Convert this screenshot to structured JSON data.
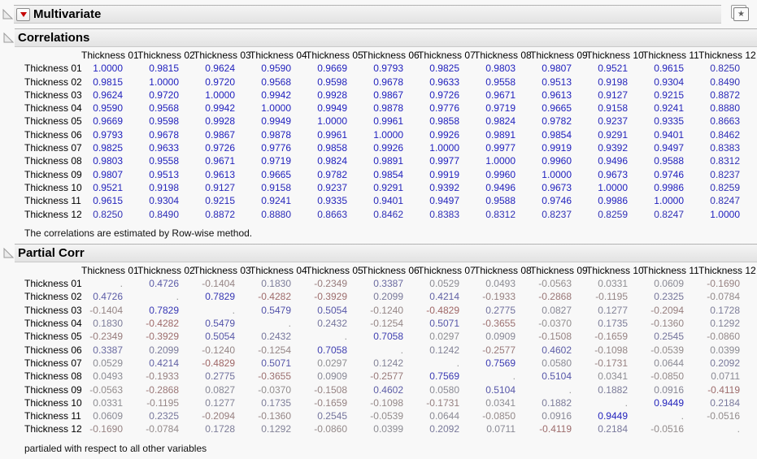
{
  "window": {
    "title": "Multivariate",
    "icons": {
      "red_triangle_menu": "red-triangle-menu",
      "disclosure_open": "open-disclosure-triangle",
      "corner": "window-star"
    }
  },
  "colors": {
    "positive": "#1e1ebe",
    "negative": "#af3737",
    "neutral": "#919191"
  },
  "sections": {
    "correlations": {
      "title": "Correlations",
      "columns": [
        "Thickness 01",
        "Thickness 02",
        "Thickness 03",
        "Thickness 04",
        "Thickness 05",
        "Thickness 06",
        "Thickness 07",
        "Thickness 08",
        "Thickness 09",
        "Thickness 10",
        "Thickness 11",
        "Thickness 12"
      ],
      "rows": [
        {
          "label": "Thickness 01",
          "values": [
            "1.0000",
            "0.9815",
            "0.9624",
            "0.9590",
            "0.9669",
            "0.9793",
            "0.9825",
            "0.9803",
            "0.9807",
            "0.9521",
            "0.9615",
            "0.8250"
          ]
        },
        {
          "label": "Thickness 02",
          "values": [
            "0.9815",
            "1.0000",
            "0.9720",
            "0.9568",
            "0.9598",
            "0.9678",
            "0.9633",
            "0.9558",
            "0.9513",
            "0.9198",
            "0.9304",
            "0.8490"
          ]
        },
        {
          "label": "Thickness 03",
          "values": [
            "0.9624",
            "0.9720",
            "1.0000",
            "0.9942",
            "0.9928",
            "0.9867",
            "0.9726",
            "0.9671",
            "0.9613",
            "0.9127",
            "0.9215",
            "0.8872"
          ]
        },
        {
          "label": "Thickness 04",
          "values": [
            "0.9590",
            "0.9568",
            "0.9942",
            "1.0000",
            "0.9949",
            "0.9878",
            "0.9776",
            "0.9719",
            "0.9665",
            "0.9158",
            "0.9241",
            "0.8880"
          ]
        },
        {
          "label": "Thickness 05",
          "values": [
            "0.9669",
            "0.9598",
            "0.9928",
            "0.9949",
            "1.0000",
            "0.9961",
            "0.9858",
            "0.9824",
            "0.9782",
            "0.9237",
            "0.9335",
            "0.8663"
          ]
        },
        {
          "label": "Thickness 06",
          "values": [
            "0.9793",
            "0.9678",
            "0.9867",
            "0.9878",
            "0.9961",
            "1.0000",
            "0.9926",
            "0.9891",
            "0.9854",
            "0.9291",
            "0.9401",
            "0.8462"
          ]
        },
        {
          "label": "Thickness 07",
          "values": [
            "0.9825",
            "0.9633",
            "0.9726",
            "0.9776",
            "0.9858",
            "0.9926",
            "1.0000",
            "0.9977",
            "0.9919",
            "0.9392",
            "0.9497",
            "0.8383"
          ]
        },
        {
          "label": "Thickness 08",
          "values": [
            "0.9803",
            "0.9558",
            "0.9671",
            "0.9719",
            "0.9824",
            "0.9891",
            "0.9977",
            "1.0000",
            "0.9960",
            "0.9496",
            "0.9588",
            "0.8312"
          ]
        },
        {
          "label": "Thickness 09",
          "values": [
            "0.9807",
            "0.9513",
            "0.9613",
            "0.9665",
            "0.9782",
            "0.9854",
            "0.9919",
            "0.9960",
            "1.0000",
            "0.9673",
            "0.9746",
            "0.8237"
          ]
        },
        {
          "label": "Thickness 10",
          "values": [
            "0.9521",
            "0.9198",
            "0.9127",
            "0.9158",
            "0.9237",
            "0.9291",
            "0.9392",
            "0.9496",
            "0.9673",
            "1.0000",
            "0.9986",
            "0.8259"
          ]
        },
        {
          "label": "Thickness 11",
          "values": [
            "0.9615",
            "0.9304",
            "0.9215",
            "0.9241",
            "0.9335",
            "0.9401",
            "0.9497",
            "0.9588",
            "0.9746",
            "0.9986",
            "1.0000",
            "0.8247"
          ]
        },
        {
          "label": "Thickness 12",
          "values": [
            "0.8250",
            "0.8490",
            "0.8872",
            "0.8880",
            "0.8663",
            "0.8462",
            "0.8383",
            "0.8312",
            "0.8237",
            "0.8259",
            "0.8247",
            "1.0000"
          ]
        }
      ],
      "footnote": "The correlations are estimated by Row-wise method."
    },
    "partial": {
      "title": "Partial Corr",
      "columns": [
        "Thickness 01",
        "Thickness 02",
        "Thickness 03",
        "Thickness 04",
        "Thickness 05",
        "Thickness 06",
        "Thickness 07",
        "Thickness 08",
        "Thickness 09",
        "Thickness 10",
        "Thickness 11",
        "Thickness 12"
      ],
      "rows": [
        {
          "label": "Thickness 01",
          "values": [
            ".",
            "0.4726",
            "-0.1404",
            "0.1830",
            "-0.2349",
            "0.3387",
            "0.0529",
            "0.0493",
            "-0.0563",
            "0.0331",
            "0.0609",
            "-0.1690"
          ]
        },
        {
          "label": "Thickness 02",
          "values": [
            "0.4726",
            ".",
            "0.7829",
            "-0.4282",
            "-0.3929",
            "0.2099",
            "0.4214",
            "-0.1933",
            "-0.2868",
            "-0.1195",
            "0.2325",
            "-0.0784"
          ]
        },
        {
          "label": "Thickness 03",
          "values": [
            "-0.1404",
            "0.7829",
            ".",
            "0.5479",
            "0.5054",
            "-0.1240",
            "-0.4829",
            "0.2775",
            "0.0827",
            "0.1277",
            "-0.2094",
            "0.1728"
          ]
        },
        {
          "label": "Thickness 04",
          "values": [
            "0.1830",
            "-0.4282",
            "0.5479",
            ".",
            "0.2432",
            "-0.1254",
            "0.5071",
            "-0.3655",
            "-0.0370",
            "0.1735",
            "-0.1360",
            "0.1292"
          ]
        },
        {
          "label": "Thickness 05",
          "values": [
            "-0.2349",
            "-0.3929",
            "0.5054",
            "0.2432",
            ".",
            "0.7058",
            "0.0297",
            "0.0909",
            "-0.1508",
            "-0.1659",
            "0.2545",
            "-0.0860"
          ]
        },
        {
          "label": "Thickness 06",
          "values": [
            "0.3387",
            "0.2099",
            "-0.1240",
            "-0.1254",
            "0.7058",
            ".",
            "0.1242",
            "-0.2577",
            "0.4602",
            "-0.1098",
            "-0.0539",
            "0.0399"
          ]
        },
        {
          "label": "Thickness 07",
          "values": [
            "0.0529",
            "0.4214",
            "-0.4829",
            "0.5071",
            "0.0297",
            "0.1242",
            ".",
            "0.7569",
            "0.0580",
            "-0.1731",
            "0.0644",
            "0.2092"
          ]
        },
        {
          "label": "Thickness 08",
          "values": [
            "0.0493",
            "-0.1933",
            "0.2775",
            "-0.3655",
            "0.0909",
            "-0.2577",
            "0.7569",
            ".",
            "0.5104",
            "0.0341",
            "-0.0850",
            "0.0711"
          ]
        },
        {
          "label": "Thickness 09",
          "values": [
            "-0.0563",
            "-0.2868",
            "0.0827",
            "-0.0370",
            "-0.1508",
            "0.4602",
            "0.0580",
            "0.5104",
            ".",
            "0.1882",
            "0.0916",
            "-0.4119"
          ]
        },
        {
          "label": "Thickness 10",
          "values": [
            "0.0331",
            "-0.1195",
            "0.1277",
            "0.1735",
            "-0.1659",
            "-0.1098",
            "-0.1731",
            "0.0341",
            "0.1882",
            ".",
            "0.9449",
            "0.2184"
          ]
        },
        {
          "label": "Thickness 11",
          "values": [
            "0.0609",
            "0.2325",
            "-0.2094",
            "-0.1360",
            "0.2545",
            "-0.0539",
            "0.0644",
            "-0.0850",
            "0.0916",
            "0.9449",
            ".",
            "-0.0516"
          ]
        },
        {
          "label": "Thickness 12",
          "values": [
            "-0.1690",
            "-0.0784",
            "0.1728",
            "0.1292",
            "-0.0860",
            "0.0399",
            "0.2092",
            "0.0711",
            "-0.4119",
            "0.2184",
            "-0.0516",
            "."
          ]
        }
      ],
      "footnote": "partialed with respect to all other variables"
    }
  }
}
